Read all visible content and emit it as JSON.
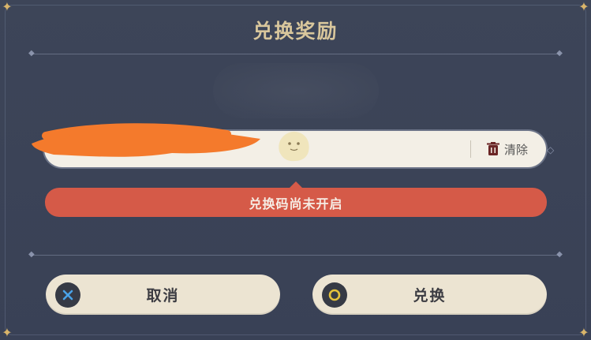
{
  "dialog": {
    "title": "兑换奖励"
  },
  "code_field": {
    "value": "",
    "placeholder": ""
  },
  "clear_button": {
    "label": "清除",
    "icon": "trash-icon"
  },
  "error": {
    "message": "兑换码尚未开启"
  },
  "buttons": {
    "cancel": {
      "label": "取消",
      "icon": "cross-icon"
    },
    "confirm": {
      "label": "兑换",
      "icon": "circle-icon"
    }
  },
  "colors": {
    "background": "#3a4256",
    "title": "#d8c69c",
    "error": "#d55a48",
    "button_bg": "#ece4d2",
    "cancel_icon": "#4aa3e8",
    "confirm_icon": "#e5c23b",
    "field_bg": "#f3efe6"
  }
}
